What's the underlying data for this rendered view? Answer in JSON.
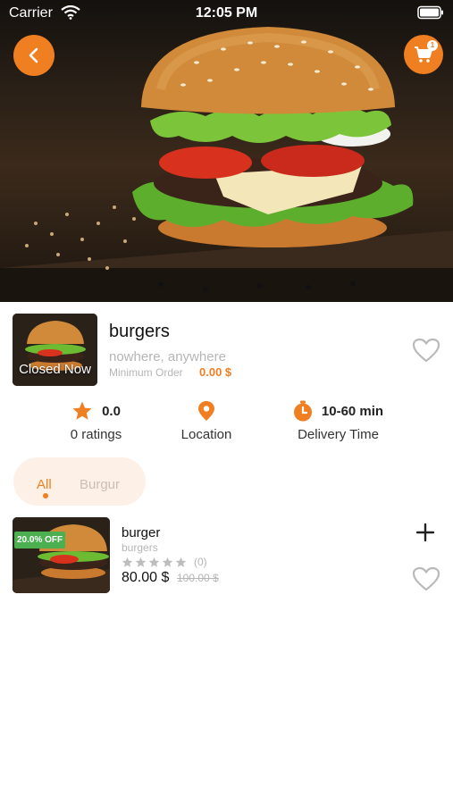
{
  "status_bar": {
    "carrier": "Carrier",
    "time": "12:05 PM"
  },
  "header": {
    "cart_count": "1"
  },
  "store": {
    "name": "burgers",
    "status": "Closed Now",
    "address": "nowhere, anywhere",
    "min_order_label": "Minimum Order",
    "min_order_value": "0.00 $"
  },
  "stats": {
    "rating_value": "0.0",
    "rating_label": "0 ratings",
    "location_label": "Location",
    "delivery_value": "10-60 min",
    "delivery_label": "Delivery Time"
  },
  "tabs": [
    {
      "label": "All",
      "active": true
    },
    {
      "label": "Burgur",
      "active": false
    }
  ],
  "products": [
    {
      "name": "burger",
      "category": "burgers",
      "discount": "20.0% OFF",
      "rating_count": "(0)",
      "stars": 0,
      "price": "80.00 $",
      "old_price": "100.00 $"
    }
  ],
  "colors": {
    "accent": "#f07f22",
    "discount": "#4caf50",
    "muted": "#b5b5b5",
    "tab_bg": "#fdf0e6"
  },
  "icons": [
    "back-arrow-icon",
    "cart-icon",
    "heart-icon",
    "star-icon",
    "location-pin-icon",
    "timer-icon",
    "plus-icon",
    "wifi-icon",
    "battery-icon"
  ]
}
